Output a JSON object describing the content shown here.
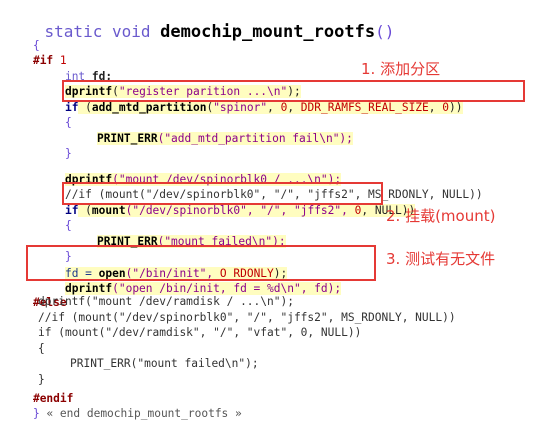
{
  "code": {
    "title_kw": "static void",
    "title_fn": "demochip_mount_rootfs",
    "title_paren": "()",
    "open_brace": "{",
    "if1_kw": "#if",
    "if1_val": "1",
    "l_int": "int",
    "l_fd": " fd;",
    "l_dprintf1": "dprintf",
    "l_dprintf1_args_open": "(",
    "l_dprintf1_str": "\"register parition ...\\n\"",
    "l_dprintf1_close": ");",
    "l_if1": "if",
    "l_if1_open": " (",
    "l_if1_fn": "add_mtd_partition",
    "l_if1_p": "(",
    "l_if1_str": "\"spinor\"",
    "l_if1_c1": ", ",
    "l_if1_zero": "0",
    "l_if1_c2": ", ",
    "l_if1_macro": "DDR_RAMFS_REAL_SIZE",
    "l_if1_c3": ", ",
    "l_if1_zero2": "0",
    "l_if1_close": "))",
    "brace_open": "{",
    "l_err1_fn": "PRINT_ERR",
    "l_err1_str": "(\"add_mtd_partition fail\\n\");",
    "brace_close": "}",
    "l_dp2": "dprintf",
    "l_dp2_rest": "(\"mount /dev/spinorblk0 / ...\\n\");",
    "l_comment": "//if (mount(\"/dev/spinorblk0\", \"/\", \"jffs2\", MS_RDONLY, NULL))",
    "l_if2": "if",
    "l_if2_open": " (",
    "l_if2_fn": "mount",
    "l_if2_rest1": "(\"/dev/spinorblk0\", \"/\", \"jffs2\", ",
    "l_if2_zero": "0",
    "l_if2_rest2": ", NULL))",
    "l_err2_fn": "PRINT_ERR",
    "l_err2_str": "(\"mount failed\\n\");",
    "l_fd_assign": "fd = ",
    "l_open_fn": "open",
    "l_open_rest1": "(\"/bin/init\", ",
    "l_open_macro": "O_RDONLY",
    "l_open_rest2": ");",
    "l_dp3": "dprintf",
    "l_dp3_rest": "(\"open /bin/init, fd = %d\\n\", fd);",
    "else_kw": "#else",
    "e1": "dprintf(\"mount /dev/ramdisk / ...\\n\");",
    "e2": "//if (mount(\"/dev/spinorblk0\", \"/\", \"jffs2\", MS_RDONLY, NULL))",
    "e3": "if (mount(\"/dev/ramdisk\", \"/\", \"vfat\", 0, NULL))",
    "e4": "{",
    "e5": "PRINT_ERR(\"mount failed\\n\");",
    "e6": "}",
    "endif_kw": "#endif",
    "end_brace": "}",
    "end_comment": " « end demochip_mount_rootfs »"
  },
  "annotations": {
    "a1": "1. 添加分区",
    "a2": "2. 挂载(mount)",
    "a3": "3. 测试有无文件"
  },
  "colors": {
    "annotation": "#e53935",
    "highlight": "#fffdc0"
  }
}
